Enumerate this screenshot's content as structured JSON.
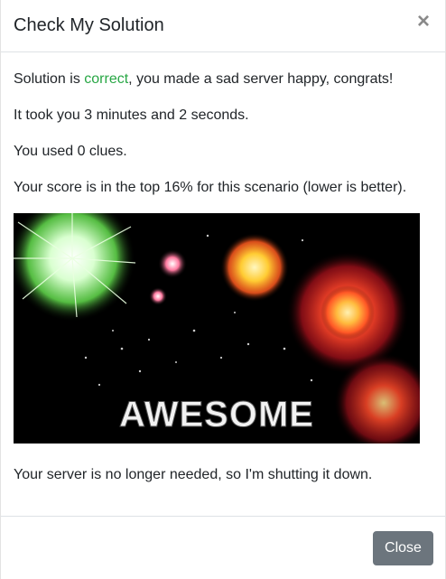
{
  "modal": {
    "title": "Check My Solution",
    "close_icon": "×"
  },
  "body": {
    "line1_prefix": "Solution is ",
    "line1_status": "correct",
    "line1_suffix": ", you made a sad server happy, congrats!",
    "line2": "It took you 3 minutes and 2 seconds.",
    "line3": "You used 0 clues.",
    "line4": "Your score is in the top 16% for this scenario (lower is better).",
    "image_text": "AWESOME",
    "line5": "Your server is no longer needed, so I'm shutting it down."
  },
  "footer": {
    "close_label": "Close"
  },
  "colors": {
    "status_correct": "#28a745",
    "button_secondary": "#6c757d"
  },
  "icons": {
    "close": "close-icon"
  }
}
